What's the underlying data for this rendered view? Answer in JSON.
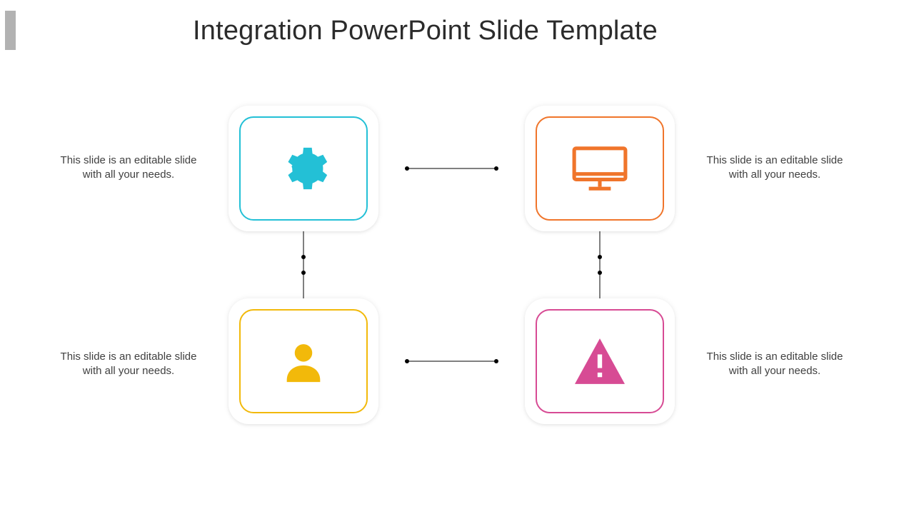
{
  "title": "Integration PowerPoint Slide Template",
  "colors": {
    "teal": "#23c0d6",
    "orange": "#f0752b",
    "yellow": "#f2b90a",
    "pink": "#d74b94",
    "accent_bar": "#b2b2b2"
  },
  "cards": {
    "top_left": {
      "icon": "gear-icon",
      "caption": "This slide is an editable slide with all your needs."
    },
    "top_right": {
      "icon": "monitor-icon",
      "caption": "This slide is an editable slide with all your needs."
    },
    "bottom_left": {
      "icon": "user-icon",
      "caption": "This slide is an editable slide with all your needs."
    },
    "bottom_right": {
      "icon": "warning-icon",
      "caption": "This slide is an editable slide with all your needs."
    }
  }
}
